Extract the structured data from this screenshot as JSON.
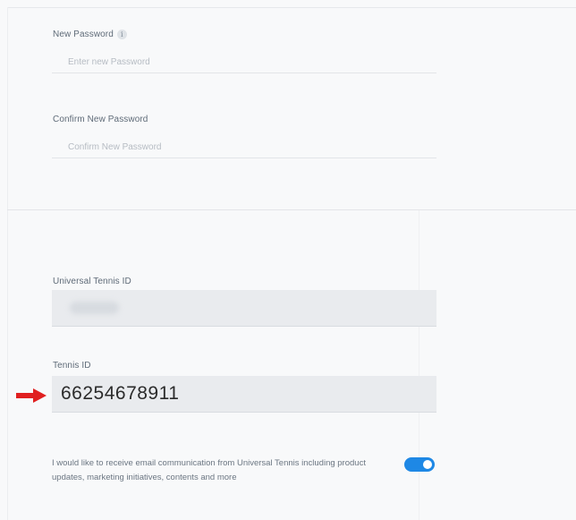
{
  "password_section": {
    "new_password": {
      "label": "New Password",
      "info_icon": "i",
      "placeholder": "Enter new Password"
    },
    "confirm_password": {
      "label": "Confirm New Password",
      "placeholder": "Confirm New Password"
    }
  },
  "id_section": {
    "universal_tennis_id": {
      "label": "Universal Tennis ID",
      "value_obscured": true
    },
    "tennis_id": {
      "label": "Tennis ID",
      "value": "66254678911"
    }
  },
  "consent": {
    "text": "I would like to receive email communication from Universal Tennis including product updates, marketing initiatives, contents and more",
    "toggle_on": true,
    "toggle_color": "#1e88e5"
  },
  "annotation": {
    "arrow_color": "#e02020",
    "arrow_icon": "red-arrow-right-icon"
  }
}
